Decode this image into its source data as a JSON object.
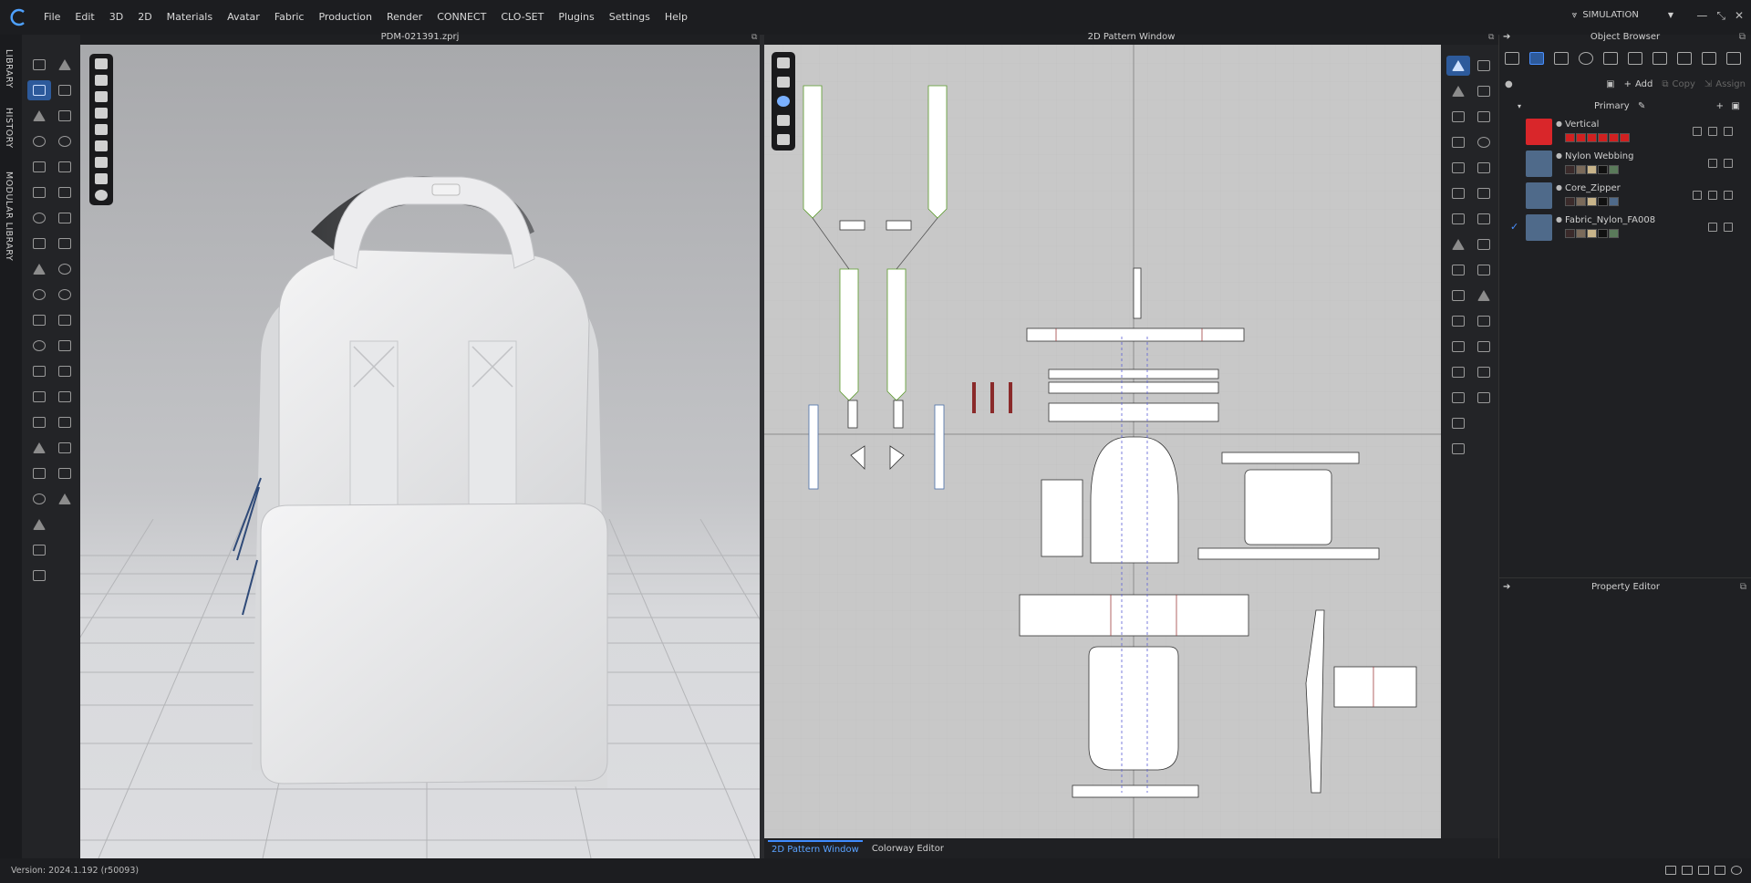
{
  "menubar": {
    "items": [
      "File",
      "Edit",
      "3D",
      "2D",
      "Materials",
      "Avatar",
      "Fabric",
      "Production",
      "Render",
      "CONNECT",
      "CLO-SET",
      "Plugins",
      "Settings",
      "Help"
    ],
    "mode_label": "SIMULATION"
  },
  "sidebar": {
    "tabs": [
      "LIBRARY",
      "HISTORY",
      "MODULAR LIBRARY"
    ]
  },
  "viewport3d": {
    "title": "PDM-021391.zprj"
  },
  "viewport2d": {
    "title": "2D Pattern Window"
  },
  "bottom_tabs": [
    "2D Pattern Window",
    "Colorway Editor"
  ],
  "object_browser": {
    "title": "Object Browser",
    "actions": {
      "add": "Add",
      "copy": "Copy",
      "assign": "Assign"
    },
    "colorway": "Primary",
    "fabrics": [
      {
        "name": "Vertical",
        "thumb_color": "#d9262a"
      },
      {
        "name": "Nylon Webbing",
        "thumb_color": "#4f6a8a"
      },
      {
        "name": "Core_Zipper",
        "thumb_color": "#4f6a8a"
      },
      {
        "name": "Fabric_Nylon_FA008",
        "thumb_color": "#4f6a8a"
      }
    ]
  },
  "property_editor": {
    "title": "Property Editor"
  },
  "status": {
    "version": "Version: 2024.1.192 (r50093)"
  },
  "colors": {
    "accent": "#3f8cff",
    "active_tool": "#2d5a9b",
    "pattern_bg": "#c8c8c8"
  }
}
